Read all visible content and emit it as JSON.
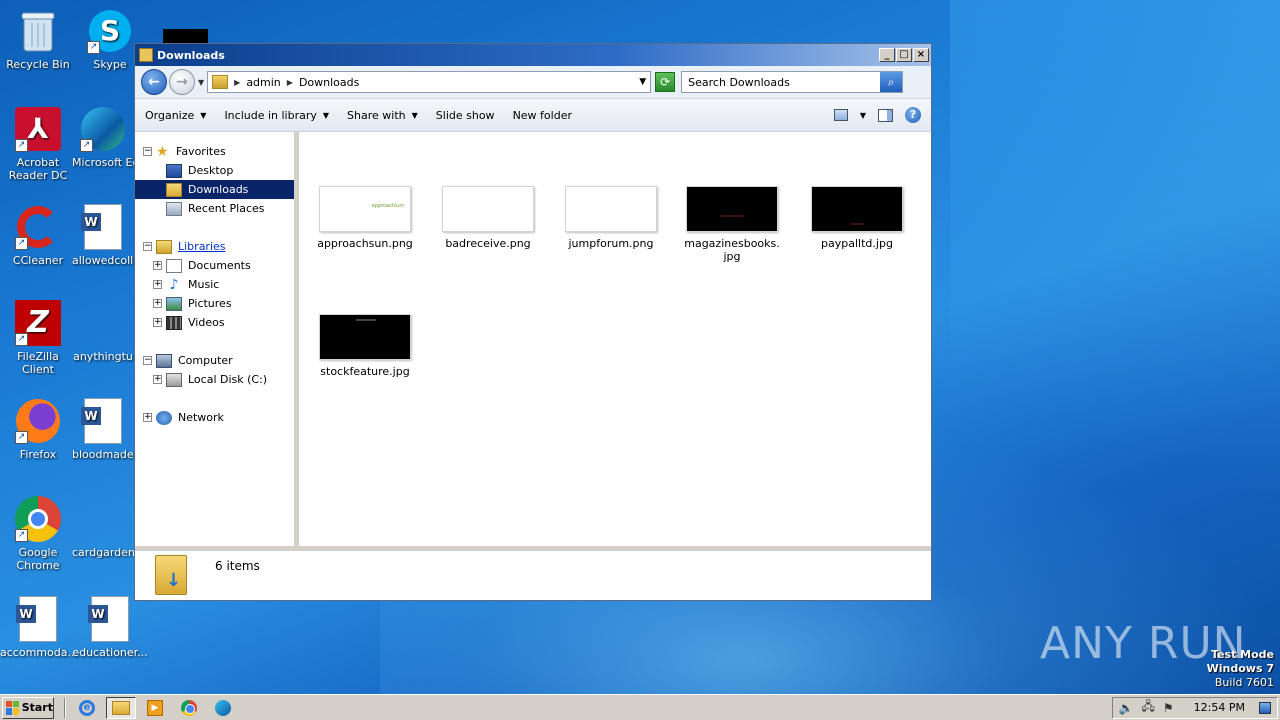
{
  "desktop": {
    "icons": [
      {
        "label": "Recycle Bin",
        "icon": "recycle-bin-icon"
      },
      {
        "label": "Skype",
        "icon": "skype-icon"
      },
      {
        "label": "Acrobat Reader DC",
        "icon": "acrobat-icon"
      },
      {
        "label": "Microsoft Ed",
        "icon": "edge-icon"
      },
      {
        "label": "CCleaner",
        "icon": "ccleaner-icon"
      },
      {
        "label": "allowedcolle",
        "icon": "word-doc-icon"
      },
      {
        "label": "FileZilla Client",
        "icon": "filezilla-icon"
      },
      {
        "label": "anythingtu",
        "icon": "blank-file-icon"
      },
      {
        "label": "Firefox",
        "icon": "firefox-icon"
      },
      {
        "label": "bloodmade.",
        "icon": "word-doc-icon"
      },
      {
        "label": "Google Chrome",
        "icon": "chrome-icon"
      },
      {
        "label": "cardgarden",
        "icon": "blank-file-icon"
      },
      {
        "label": "accommoda...",
        "icon": "word-doc-icon"
      },
      {
        "label": "educationer...",
        "icon": "word-doc-icon"
      }
    ]
  },
  "window": {
    "title": "Downloads",
    "controls": {
      "minimize": "_",
      "maximize": "□",
      "close": "×"
    }
  },
  "address": {
    "path": [
      "admin",
      "Downloads"
    ],
    "search_placeholder": "Search Downloads"
  },
  "toolbar": {
    "organize": "Organize",
    "include_in_library": "Include in library",
    "share_with": "Share with",
    "slide_show": "Slide show",
    "new_folder": "New folder"
  },
  "navpane": {
    "favorites": "Favorites",
    "desktop": "Desktop",
    "downloads": "Downloads",
    "recent_places": "Recent Places",
    "libraries": "Libraries",
    "documents": "Documents",
    "music": "Music",
    "pictures": "Pictures",
    "videos": "Videos",
    "computer": "Computer",
    "local_disk": "Local Disk (C:)",
    "network": "Network"
  },
  "files": [
    {
      "name": "approachsun.png",
      "thumb": "white",
      "thumb_text": "approachsun"
    },
    {
      "name": "badreceive.png",
      "thumb": "white"
    },
    {
      "name": "jumpforum.png",
      "thumb": "white"
    },
    {
      "name": "magazinesbooks.jpg",
      "thumb": "black"
    },
    {
      "name": "paypalltd.jpg",
      "thumb": "black"
    },
    {
      "name": "stockfeature.jpg",
      "thumb": "black"
    }
  ],
  "details": {
    "count": "6 items"
  },
  "watermark": {
    "brand": "ANY RUN",
    "mode": "Test Mode",
    "os": "Windows 7",
    "build": "Build 7601"
  },
  "taskbar": {
    "start": "Start",
    "clock": "12:54 PM"
  }
}
